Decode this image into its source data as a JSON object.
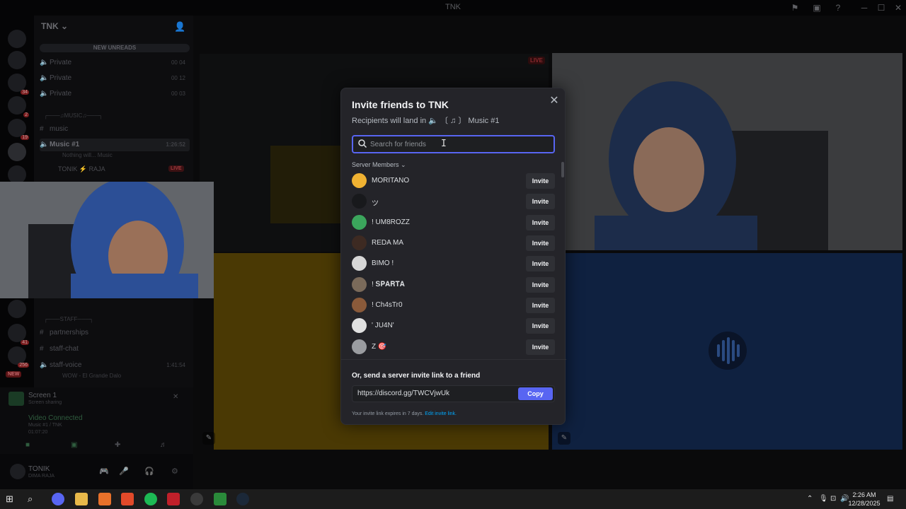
{
  "window": {
    "title": "TNK"
  },
  "sidebar": {
    "server_name": "TNK",
    "new_unreads": "NEW UNREADS",
    "channels": [
      {
        "name": "Private",
        "count": "00 04"
      },
      {
        "name": "Private",
        "count": "00 12"
      },
      {
        "name": "Private",
        "count": "00 03"
      }
    ],
    "music_category": "┌───♫MUSIC♫───┐",
    "music_channel": "music",
    "active_channel": "Music #1",
    "active_timer": "1:26:52",
    "active_sub": "Nothing will... Music",
    "voice_user": "TONIK",
    "voice_user_tag": "RAJA",
    "live": "LIVE",
    "staff_category": "┌───STAFF───┐",
    "partnerships": "partnerships",
    "staff_chat": "staff-chat",
    "staff_voice": "staff-voice",
    "staff_voice_timer": "1:41:54",
    "staff_voice_sub": "WOW - El Grande Dalo",
    "screen_label": "Screen 1",
    "screen_sub": "Screen sharing",
    "video_connected": "Video Connected",
    "video_sub": "Music #1 / TNK",
    "video_timer": "01:07:20",
    "username": "TONIK",
    "user_status": "DIMA RAJA",
    "new_badge": "NEW"
  },
  "stage": {
    "live_tag": "LIVE"
  },
  "modal": {
    "title": "Invite friends to TNK",
    "recipients_prefix": "Recipients will land in",
    "recipients_channel": "〔 ♫ 〕 Music #1",
    "search_placeholder": "Search for friends",
    "section_label": "Server Members",
    "invite_label": "Invite",
    "members": [
      {
        "name": "MORITANO",
        "color": "#f0b232"
      },
      {
        "name": "ツ",
        "color": "#18191c"
      },
      {
        "name": "! UM8ROZZ",
        "color": "#3ba55c"
      },
      {
        "name": "REDA MA",
        "color": "#3d2a22"
      },
      {
        "name": "BIMO !",
        "color": "#d6d6d6"
      },
      {
        "name": "! 𝐒𝐏𝐀𝐑𝐓𝐀",
        "color": "#7a6a5a"
      },
      {
        "name": "! Ch4sTr0",
        "color": "#8a5a3a"
      },
      {
        "name": "' JU4N'",
        "color": "#e0e0e0"
      },
      {
        "name": "Z 🎯",
        "color": "#9a9ca0"
      }
    ],
    "link_label": "Or, send a server invite link to a friend",
    "invite_url": "https://discord.gg/TWCVjwUk",
    "copy_label": "Copy",
    "expire_text": "Your invite link expires in 7 days.",
    "edit_link": "Edit invite link."
  },
  "taskbar": {
    "time": "2:26 AM",
    "date": "12/28/2025"
  },
  "colors": {
    "accent": "#5865f2",
    "modal_bg": "#242429",
    "live_red": "#a03a3e"
  }
}
